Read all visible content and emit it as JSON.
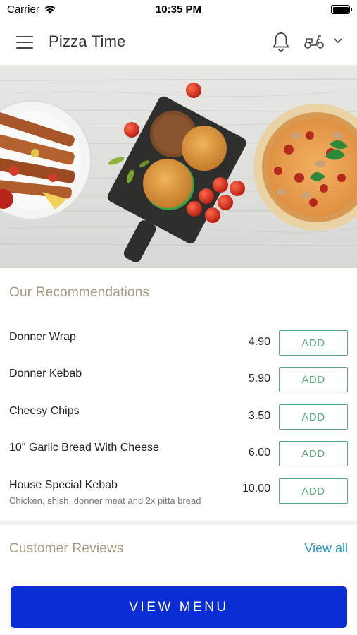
{
  "status_bar": {
    "carrier": "Carrier",
    "time": "10:35 PM"
  },
  "header": {
    "title": "Pizza Time",
    "icons": [
      "menu-icon",
      "bell-icon",
      "scooter-icon",
      "chevron-down-icon"
    ]
  },
  "recommendations": {
    "title": "Our Recommendations",
    "items": [
      {
        "name": "Donner Wrap",
        "price": "4.90",
        "add_label": "ADD"
      },
      {
        "name": "Donner Kebab",
        "price": "5.90",
        "add_label": "ADD"
      },
      {
        "name": "Cheesy Chips",
        "price": "3.50",
        "add_label": "ADD"
      },
      {
        "name": "10\" Garlic Bread With Cheese",
        "price": "6.00",
        "add_label": "ADD"
      },
      {
        "name": "House Special Kebab",
        "description": "Chicken, shish, donner meat and 2x pitta bread",
        "price": "10.00",
        "add_label": "ADD"
      }
    ]
  },
  "reviews": {
    "title": "Customer Reviews",
    "view_all": "View all"
  },
  "cta": {
    "view_menu": "VIEW MENU"
  },
  "colors": {
    "accent_gold": "#a59a7d",
    "add_green": "#5aa97a",
    "link_blue": "#2d9ad0",
    "cta_blue": "#0a2dd6"
  }
}
